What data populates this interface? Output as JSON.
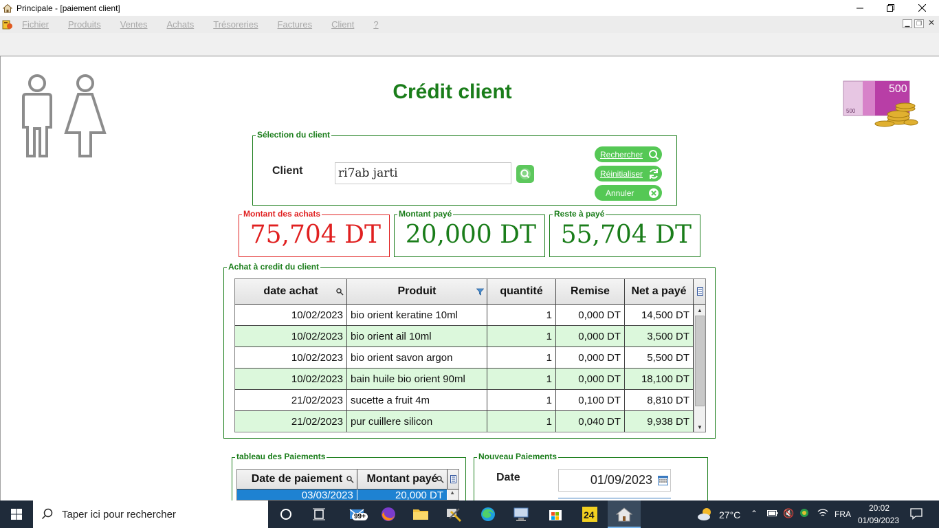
{
  "window": {
    "title": "Principale - [paiement client]"
  },
  "menu": {
    "items": [
      "Fichier",
      "Produits",
      "Ventes",
      "Achats",
      "Trésoreries",
      "Factures",
      "Client",
      "?"
    ]
  },
  "page": {
    "title": "Crédit client"
  },
  "client_selection": {
    "group_label": "Sélection du client",
    "client_label": "Client",
    "client_value": "ri7ab jarti",
    "buttons": {
      "search": "Rechercher",
      "reset": "Réinitialiser",
      "cancel": "Annuler"
    }
  },
  "amounts": {
    "purchases": {
      "label": "Montant des achats",
      "value": "75,704 DT",
      "color": "#e02020"
    },
    "paid": {
      "label": "Montant payé",
      "value": "20,000 DT",
      "color": "#1a7d1a"
    },
    "remaining": {
      "label": "Reste à payé",
      "value": "55,704 DT",
      "color": "#1a7d1a"
    }
  },
  "credit_purchases": {
    "group_label": "Achat à credit du client",
    "columns": [
      "date achat",
      "Produit",
      "quantité",
      "Remise",
      "Net a payé"
    ],
    "rows": [
      [
        "10/02/2023",
        "bio orient keratine 10ml",
        "1",
        "0,000 DT",
        "14,500 DT"
      ],
      [
        "10/02/2023",
        "bio orient ail 10ml",
        "1",
        "0,000 DT",
        "3,500 DT"
      ],
      [
        "10/02/2023",
        "bio orient savon argon",
        "1",
        "0,000 DT",
        "5,500 DT"
      ],
      [
        "10/02/2023",
        "bain huile bio orient 90ml",
        "1",
        "0,000 DT",
        "18,100 DT"
      ],
      [
        "21/02/2023",
        "sucette a fruit 4m",
        "1",
        "0,100 DT",
        "8,810 DT"
      ],
      [
        "21/02/2023",
        "pur cuillere silicon",
        "1",
        "0,040 DT",
        "9,938 DT"
      ]
    ]
  },
  "payments_table": {
    "group_label": "tableau des Paiements",
    "columns": [
      "Date de paiement",
      "Montant payé"
    ],
    "rows": [
      [
        "03/03/2023",
        "20,000 DT"
      ]
    ]
  },
  "new_payment": {
    "group_label": "Nouveau Paiements",
    "date_label": "Date",
    "date_value": "01/09/2023"
  },
  "taskbar": {
    "search_placeholder": "Taper ici pour rechercher",
    "mail_badge": "99+",
    "weather": "27°C",
    "language": "FRA",
    "time": "20:02",
    "date": "01/09/2023"
  },
  "colors": {
    "accent_green": "#1a7d1a",
    "button_green": "#55c855",
    "row_alt": "#dcf8dc",
    "selection_blue": "#1e82d2"
  }
}
